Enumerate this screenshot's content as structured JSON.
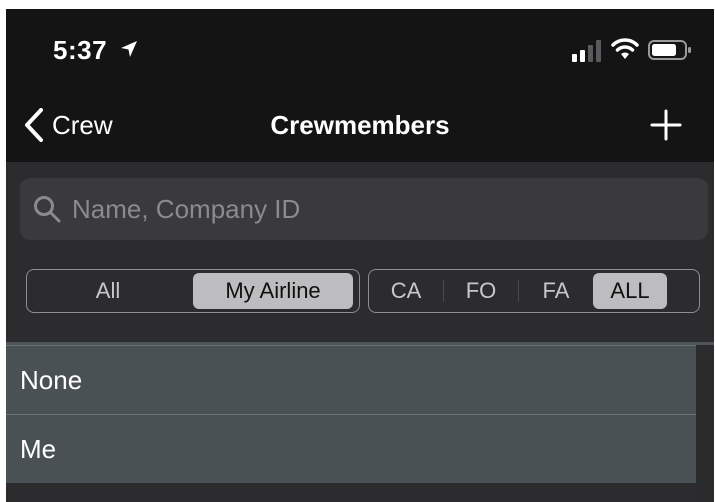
{
  "status_bar": {
    "time": "5:37",
    "icons": [
      "location-arrow-icon",
      "cellular-signal-icon",
      "wifi-icon",
      "battery-icon"
    ]
  },
  "nav": {
    "back_label": "Crew",
    "title": "Crewmembers",
    "add_icon": "plus-icon"
  },
  "search": {
    "placeholder": "Name, Company ID",
    "value": ""
  },
  "filters": {
    "scope": {
      "options": [
        "All",
        "My Airline"
      ],
      "selected": "My Airline"
    },
    "role": {
      "options": [
        "CA",
        "FO",
        "FA",
        "ALL"
      ],
      "selected": "ALL"
    }
  },
  "list": {
    "items": [
      "None",
      "Me"
    ]
  },
  "colors": {
    "topbar": "#141414",
    "background": "#2c2c2e",
    "search_field": "#3a3a3c",
    "segment_selected": "#bdbdbf",
    "list_row": "#4a5154"
  }
}
